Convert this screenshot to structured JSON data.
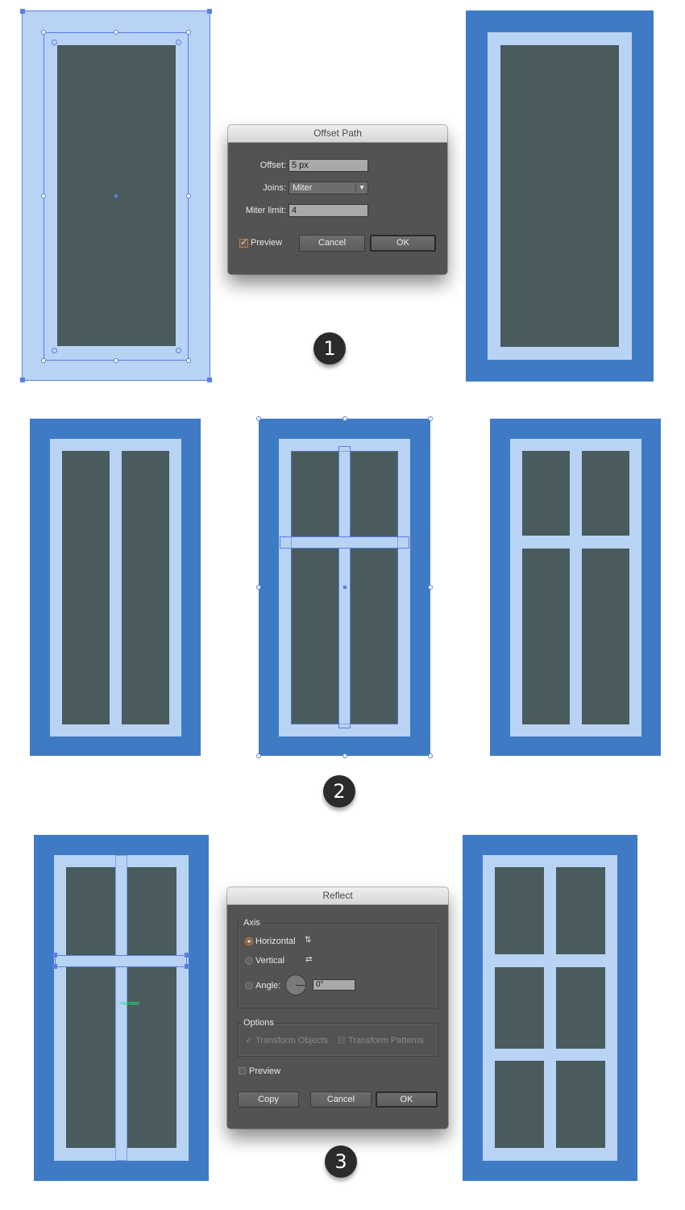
{
  "step1": {
    "badge": "1",
    "offset_dialog": {
      "title": "Offset Path",
      "offset_label": "Offset:",
      "offset_value": "5 px",
      "joins_label": "Joins:",
      "joins_value": "Miter",
      "miter_limit_label": "Miter limit:",
      "miter_limit_value": "4",
      "preview_label": "Preview",
      "preview_checked": true,
      "cancel_label": "Cancel",
      "ok_label": "OK"
    }
  },
  "step2": {
    "badge": "2"
  },
  "step3": {
    "badge": "3",
    "smart_guide_label": "center",
    "reflect_dialog": {
      "title": "Reflect",
      "axis_group_label": "Axis",
      "horizontal_label": "Horizontal",
      "vertical_label": "Vertical",
      "angle_label": "Angle:",
      "angle_value": "0°",
      "selected_axis": "Horizontal",
      "options_group_label": "Options",
      "transform_objects_label": "Transform Objects",
      "transform_objects_checked": true,
      "transform_patterns_label": "Transform Patterns",
      "transform_patterns_checked": false,
      "preview_label": "Preview",
      "preview_checked": false,
      "copy_label": "Copy",
      "cancel_label": "Cancel",
      "ok_label": "OK"
    }
  },
  "colors": {
    "frame_blue": "#3f7bc5",
    "frame_light": "#b8d3f3",
    "glass": "#4a5b5d",
    "selection": "#5b7ee0",
    "dialog_bg": "#535353"
  }
}
